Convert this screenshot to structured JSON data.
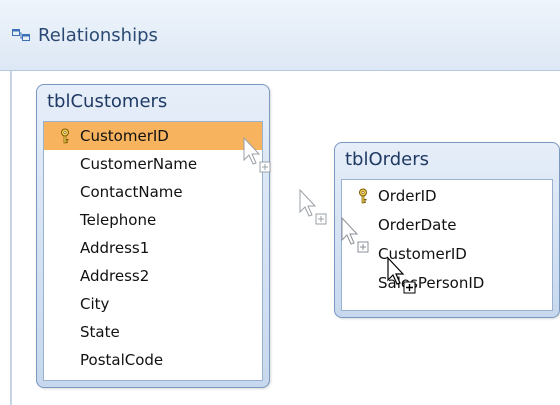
{
  "window": {
    "title": "Relationships",
    "title_icon": "relationships-icon"
  },
  "tables": [
    {
      "name": "tblCustomers",
      "fields": [
        {
          "label": "CustomerID",
          "primary_key": true,
          "selected": true
        },
        {
          "label": "CustomerName",
          "primary_key": false,
          "selected": false
        },
        {
          "label": "ContactName",
          "primary_key": false,
          "selected": false
        },
        {
          "label": "Telephone",
          "primary_key": false,
          "selected": false
        },
        {
          "label": "Address1",
          "primary_key": false,
          "selected": false
        },
        {
          "label": "Address2",
          "primary_key": false,
          "selected": false
        },
        {
          "label": "City",
          "primary_key": false,
          "selected": false
        },
        {
          "label": "State",
          "primary_key": false,
          "selected": false
        },
        {
          "label": "PostalCode",
          "primary_key": false,
          "selected": false
        }
      ]
    },
    {
      "name": "tblOrders",
      "fields": [
        {
          "label": "OrderID",
          "primary_key": true,
          "selected": false
        },
        {
          "label": "OrderDate",
          "primary_key": false,
          "selected": false
        },
        {
          "label": "CustomerID",
          "primary_key": false,
          "selected": false
        },
        {
          "label": "SalesPersonID",
          "primary_key": false,
          "selected": false
        }
      ]
    }
  ],
  "colors": {
    "selected_field": "#f7b35e",
    "table_border": "#7a98c0",
    "title_text": "#1f3a63"
  },
  "icons": {
    "key": "primary-key-icon",
    "drag_cursor": "drag-copy-cursor-icon"
  }
}
